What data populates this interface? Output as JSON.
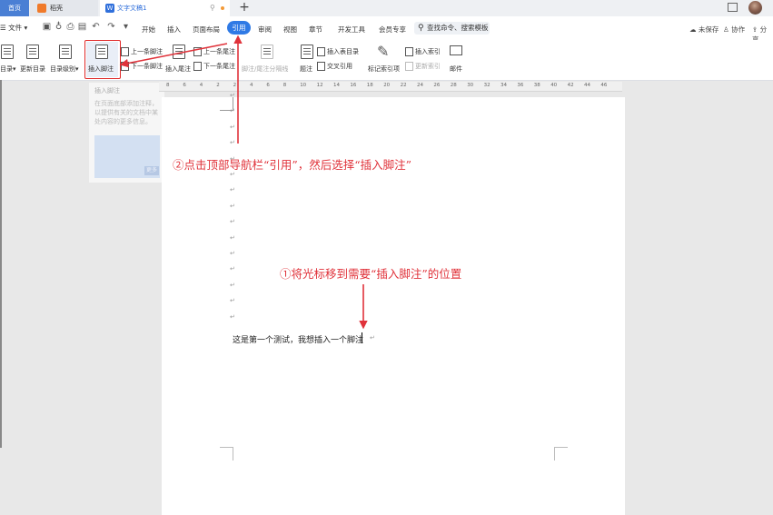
{
  "tabs": [
    {
      "label": "首页"
    },
    {
      "label": "稻壳"
    },
    {
      "label": "文字文稿1"
    }
  ],
  "menu": {
    "file": "☰ 文件 ▾",
    "items": [
      "开始",
      "插入",
      "页面布局",
      "引用",
      "审阅",
      "视图",
      "章节",
      "开发工具",
      "会员专享"
    ],
    "search_label": "查找命令、搜索模板",
    "right": [
      "未保存",
      "协作",
      "分享"
    ]
  },
  "ribbon": {
    "toc": "目录",
    "update_toc": "更新目录",
    "toc_level": "目录级别",
    "insert_footnote": "插入脚注",
    "prev_footnote": "上一条脚注",
    "next_footnote": "下一条脚注",
    "insert_endnote": "插入尾注",
    "prev_endnote": "上一条尾注",
    "next_endnote": "下一条尾注",
    "footnote_sep": "脚注/尾注分隔线",
    "caption": "题注",
    "insert_table_toc": "插入表目录",
    "cross_ref": "交叉引用",
    "mark_index": "标记索引项",
    "insert_index": "插入索引",
    "update_index": "更新索引",
    "mail": "邮件"
  },
  "tooltip": {
    "title": "插入脚注",
    "desc": "在页面底部添加注释，以提供有关的文档中某处内容的更多信息。",
    "more": "更多"
  },
  "ruler_numbers": [
    "8",
    "6",
    "4",
    "2",
    "2",
    "4",
    "6",
    "8",
    "10",
    "12",
    "14",
    "16",
    "18",
    "20",
    "22",
    "24",
    "26",
    "28",
    "30",
    "32",
    "34",
    "36",
    "38",
    "40",
    "42",
    "44",
    "46"
  ],
  "document": {
    "body_text": "这是第一个测试，我想插入一个脚注",
    "paragraph_mark": "↵"
  },
  "annotations": {
    "step2": "②点击顶部导航栏“引用”，然后选择“插入脚注”",
    "step1": "①将光标移到需要“插入脚注”的位置"
  },
  "colors": {
    "accent_blue": "#2f7ae5",
    "annotation_red": "#e0323a"
  }
}
